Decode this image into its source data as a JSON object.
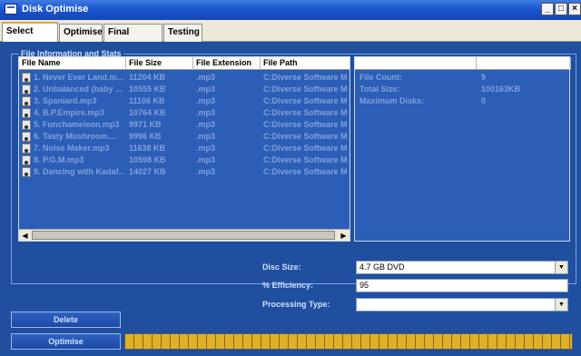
{
  "window": {
    "title": "Disk Optimise",
    "buttons": [
      "_",
      "□",
      "×"
    ]
  },
  "tabs": [
    {
      "label": "Select Files",
      "active": true
    },
    {
      "label": "Optimise",
      "active": false
    },
    {
      "label": "Final Results",
      "active": false
    },
    {
      "label": "Testing",
      "active": false
    }
  ],
  "group": {
    "title": "File Information and Stats"
  },
  "file_list": {
    "columns": [
      "File Name",
      "File Size",
      "File Extension",
      "File Path"
    ],
    "rows": [
      {
        "name": "1. Never Ever Land.m...",
        "size": "11204 KB",
        "ext": ".mp3",
        "path": "C:Diverse Software M"
      },
      {
        "name": "2. Unbalanced (baby ...",
        "size": "10555 KB",
        "ext": ".mp3",
        "path": "C:Diverse Software M"
      },
      {
        "name": "3. Spaniard.mp3",
        "size": "11106 KB",
        "ext": ".mp3",
        "path": "C:Diverse Software M"
      },
      {
        "name": "4. B.P.Empire.mp3",
        "size": "10764 KB",
        "ext": ".mp3",
        "path": "C:Diverse Software M"
      },
      {
        "name": "5. Funchameleon.mp3",
        "size": "9971 KB",
        "ext": ".mp3",
        "path": "C:Diverse Software M"
      },
      {
        "name": "6. Tasty Mushroom....",
        "size": "9996 KB",
        "ext": ".mp3",
        "path": "C:Diverse Software M"
      },
      {
        "name": "7. Noise Maker.mp3",
        "size": "11638 KB",
        "ext": ".mp3",
        "path": "C:Diverse Software M"
      },
      {
        "name": "8. P.G.M.mp3",
        "size": "10598 KB",
        "ext": ".mp3",
        "path": "C:Diverse Software M"
      },
      {
        "name": "9. Dancing with Kadaf...",
        "size": "14027 KB",
        "ext": ".mp3",
        "path": "C:Diverse Software M"
      }
    ]
  },
  "stats": [
    {
      "label": "File Count:",
      "value": "9"
    },
    {
      "label": "Total Size:",
      "value": "100163KB"
    },
    {
      "label": "Maximum Disks:",
      "value": "0"
    }
  ],
  "form": {
    "disc_size_label": "Disc Size:",
    "disc_size_value": "4.7 GB DVD",
    "efficiency_label": "% Efficiency:",
    "efficiency_value": "95",
    "processing_type_label": "Processing Type:",
    "processing_type_value": ""
  },
  "buttons": {
    "delete": "Delete",
    "optimise": "Optimise"
  },
  "icons": {
    "app": "app-window-icon",
    "file": "audio-file-icon",
    "scroll_left": "◀",
    "scroll_right": "▶",
    "dropdown": "▼"
  },
  "colors": {
    "background": "#1f4f9e",
    "titlebar": "#1b56cf",
    "progress": "#ddb12a"
  }
}
